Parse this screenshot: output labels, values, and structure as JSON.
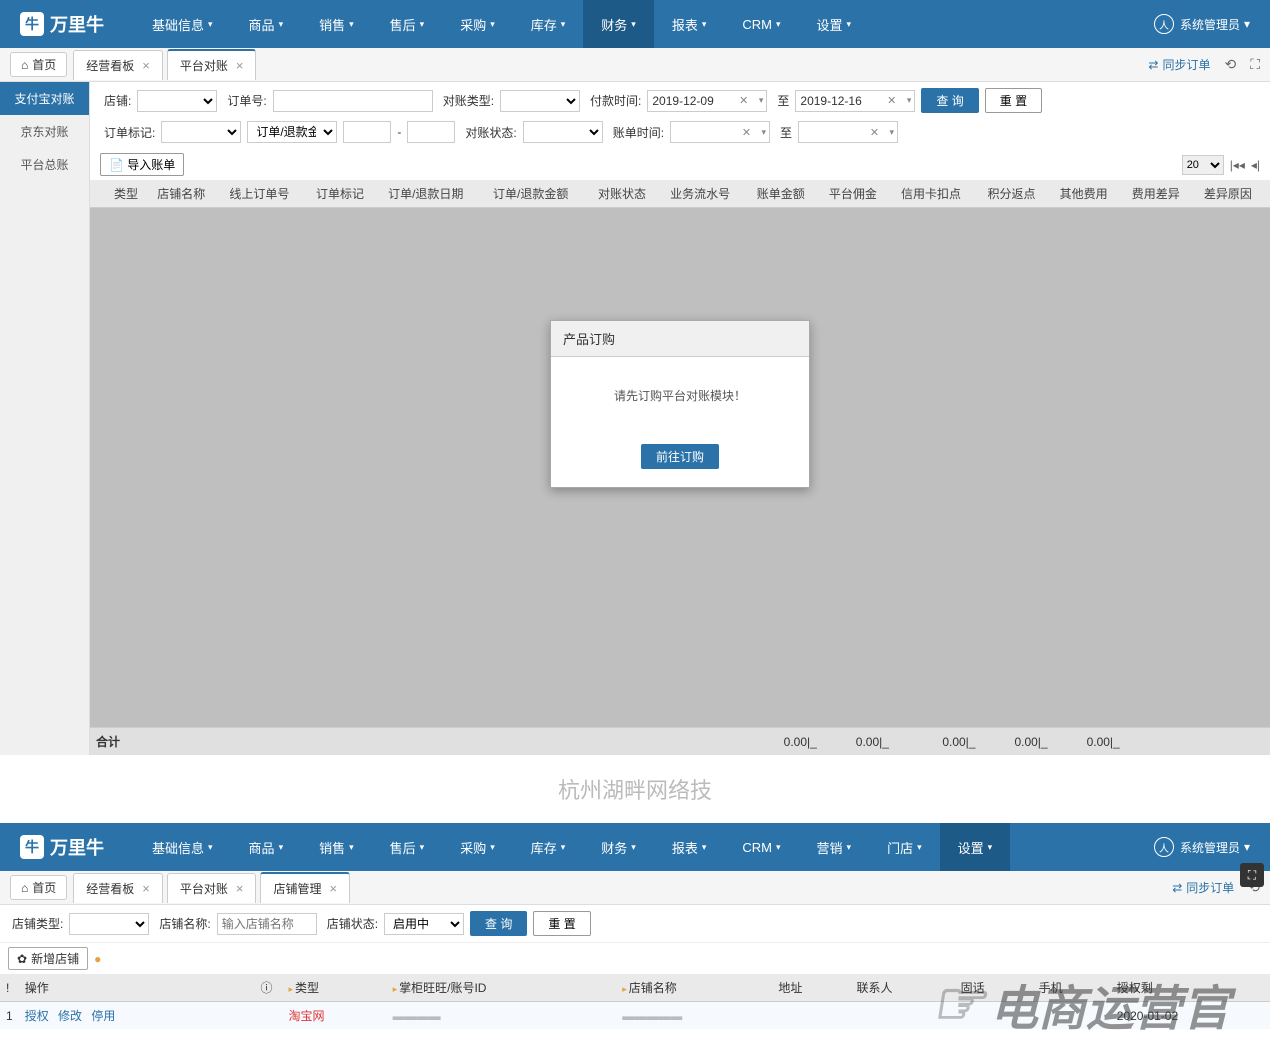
{
  "app": {
    "logo_text": "万里牛"
  },
  "nav": {
    "items": [
      "基础信息",
      "商品",
      "销售",
      "售后",
      "采购",
      "库存",
      "财务",
      "报表",
      "CRM",
      "设置"
    ],
    "active_index": 6,
    "user_label": "系统管理员"
  },
  "nav2": {
    "items": [
      "基础信息",
      "商品",
      "销售",
      "售后",
      "采购",
      "库存",
      "财务",
      "报表",
      "CRM",
      "营销",
      "门店",
      "设置"
    ],
    "active_index": 11,
    "user_label": "系统管理员"
  },
  "tabs": {
    "home": "首页",
    "items": [
      "经营看板",
      "平台对账"
    ],
    "active_index": 1,
    "sync_label": "同步订单"
  },
  "tabs2": {
    "home": "首页",
    "items": [
      "经营看板",
      "平台对账",
      "店铺管理"
    ],
    "active_index": 2,
    "sync_label": "同步订单"
  },
  "sidebar": {
    "items": [
      "支付宝对账",
      "京东对账",
      "平台总账"
    ],
    "active_index": 0
  },
  "filters": {
    "shop_label": "店铺:",
    "order_no_label": "订单号:",
    "recon_type_label": "对账类型:",
    "pay_time_label": "付款时间:",
    "to_label": "至",
    "date_from": "2019-12-09",
    "date_to": "2019-12-16",
    "query_btn": "查 询",
    "reset_btn": "重 置",
    "order_mark_label": "订单标记:",
    "refund_amt_label": "订单/退款金额",
    "dash": "-",
    "recon_status_label": "对账状态:",
    "bill_time_label": "账单时间:"
  },
  "toolbar": {
    "import_btn": "导入账单",
    "page_size": "20"
  },
  "table": {
    "headers": [
      "",
      "类型",
      "店铺名称",
      "线上订单号",
      "订单标记",
      "订单/退款日期",
      "订单/退款金额",
      "对账状态",
      "业务流水号",
      "账单金额",
      "平台佣金",
      "信用卡扣点",
      "积分返点",
      "其他费用",
      "费用差异",
      "差异原因"
    ],
    "footer_label": "合计",
    "footer_vals": [
      "0.00|_",
      "0.00|_",
      "0.00|_",
      "0.00|_",
      "0.00|_"
    ]
  },
  "modal": {
    "title": "产品订购",
    "message": "请先订购平台对账模块！",
    "button": "前往订购"
  },
  "watermark": "杭州湖畔网络技",
  "filters2": {
    "shop_type_label": "店铺类型:",
    "shop_name_label": "店铺名称:",
    "shop_name_placeholder": "输入店铺名称",
    "shop_status_label": "店铺状态:",
    "shop_status_value": "启用中",
    "query_btn": "查 询",
    "reset_btn": "重 置"
  },
  "tool2": {
    "add_shop": "新增店铺"
  },
  "table2": {
    "headers": [
      "",
      "操作",
      "",
      "类型",
      "掌柜旺旺/账号ID",
      "店铺名称",
      "地址",
      "联系人",
      "固话",
      "手机",
      "授权剩"
    ],
    "row": {
      "idx": "1",
      "ops": [
        "授权",
        "修改",
        "停用"
      ],
      "type": "淘宝网",
      "auth_end": "2020-01-02"
    }
  },
  "overlay_brand": "电商运营官"
}
